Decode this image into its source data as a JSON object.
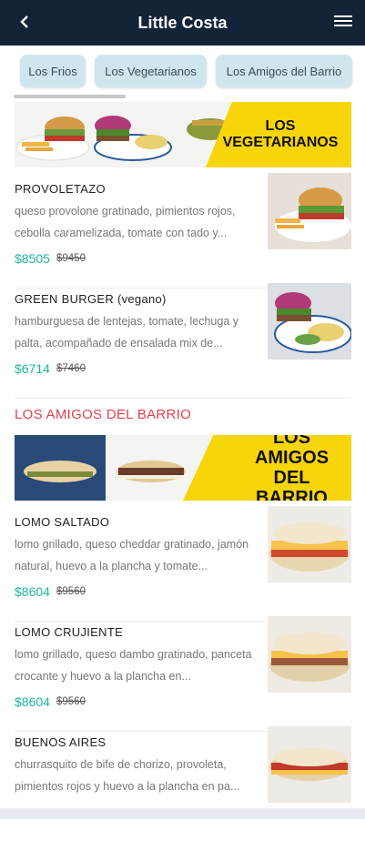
{
  "header": {
    "title": "Little Costa"
  },
  "chips": [
    {
      "label": "Los Frios"
    },
    {
      "label": "Los Vegetarianos"
    },
    {
      "label": "Los Amigos del Barrio"
    }
  ],
  "banners": {
    "vegetarianos": "LOS VEGETARIANOS",
    "amigos": "LOS AMIGOS DEL BARRIO"
  },
  "section": {
    "amigos_title": "LOS AMIGOS DEL BARRIO"
  },
  "items": [
    {
      "name": "PROVOLETAZO",
      "desc": "queso provolone gratinado, pimientos rojos, cebolla caramelizada, tomate con tado y...",
      "price": "$8505",
      "old_price": "$9450"
    },
    {
      "name": "GREEN BURGER (vegano)",
      "desc": "hamburguesa de lentejas, tomate, lechuga y palta, acompañado de ensalada mix de...",
      "price": "$6714",
      "old_price": "$7460"
    },
    {
      "name": "LOMO SALTADO",
      "desc": "lomo grillado, queso cheddar gratinado, jamón natural, huevo a la plancha y tomate...",
      "price": "$8604",
      "old_price": "$9560"
    },
    {
      "name": "LOMO CRUJIENTE",
      "desc": "lomo grillado, queso dambo gratinado, panceta crocante y huevo a la plancha en...",
      "price": "$8604",
      "old_price": "$9560"
    },
    {
      "name": "BUENOS AIRES",
      "desc": "churrasquito de bife de chorizo, provoleta, pimientos rojos y huevo a la plancha en pa...",
      "price": "",
      "old_price": ""
    }
  ],
  "icons": {
    "back": "chevron-left-icon",
    "menu": "hamburger-menu-icon"
  },
  "colors": {
    "header_bg": "#132338",
    "price": "#1fb59c",
    "section_title": "#e04050",
    "chip_bg": "#cfe6ee",
    "banner_yellow": "#f7d50b"
  }
}
